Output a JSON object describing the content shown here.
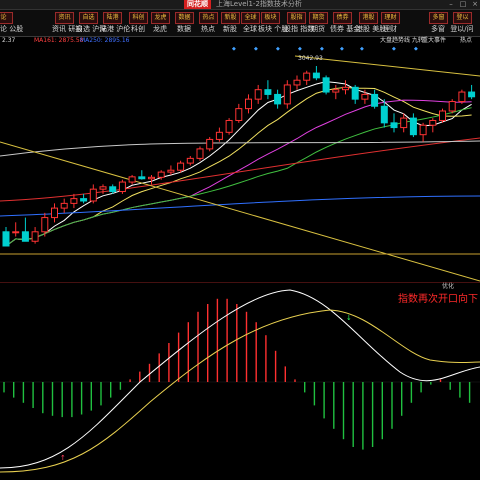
{
  "window": {
    "title": "上海Level1-2指数技术分析",
    "logo": "同花顺"
  },
  "toolbar": {
    "buttons": [
      {
        "label": "论 公股",
        "icon": "论"
      },
      {
        "label": "资讯 研报",
        "icon": "资讯"
      },
      {
        "label": "自选 沪深",
        "icon": "自选"
      },
      {
        "label": "陆港 沪伦",
        "icon": "陆港"
      },
      {
        "label": "科创",
        "icon": "科创"
      },
      {
        "label": "龙虎",
        "icon": "龙虎"
      },
      {
        "label": "数据",
        "icon": "数据"
      },
      {
        "label": "热点",
        "icon": "热点"
      },
      {
        "label": "新股",
        "icon": "新股"
      },
      {
        "label": "全球",
        "icon": "全球"
      },
      {
        "label": "板块 个股",
        "icon": "板块"
      },
      {
        "label": "股指 指数",
        "icon": "股指"
      },
      {
        "label": "期货",
        "icon": "期货"
      },
      {
        "label": "债券 基金",
        "icon": "债券"
      },
      {
        "label": "港股 美股",
        "icon": "港股"
      },
      {
        "label": "理财",
        "icon": "理财"
      },
      {
        "label": "多窗",
        "icon": "多窗"
      },
      {
        "label": "登以/问",
        "icon": "登以"
      }
    ]
  },
  "indicator_bar": {
    "left_value": "2.37",
    "ma60": "MA161: 2875.58",
    "ma250": "MA250: 2895.16",
    "right_items": [
      "大盘趋势线 九转",
      "重大事件",
      "热点"
    ]
  },
  "main_chart": {
    "high_label": "3042.93",
    "colors": {
      "up": "#ff3333",
      "down": "#00d0d0",
      "ma5": "#ffffff",
      "ma10": "#f0e060",
      "ma20": "#e040e0",
      "ma30": "#40c040",
      "ma60": "#e03030",
      "ma250": "#3070ff",
      "trendline": "#d8c040"
    },
    "candles": [
      [
        3,
        4,
        1,
        0
      ],
      [
        3,
        5,
        2,
        3
      ],
      [
        3,
        6,
        2,
        1
      ],
      [
        1,
        4,
        0.5,
        3
      ],
      [
        3,
        7,
        2,
        6
      ],
      [
        6,
        9,
        5,
        8
      ],
      [
        8,
        10,
        7,
        9
      ],
      [
        9,
        11,
        8,
        10
      ],
      [
        10,
        11,
        9,
        9.5
      ],
      [
        9.5,
        13,
        9,
        12
      ],
      [
        12,
        13,
        11,
        12.5
      ],
      [
        12.5,
        13,
        11,
        11.5
      ],
      [
        11.5,
        14,
        11,
        13.5
      ],
      [
        13.5,
        15,
        13,
        14.6
      ],
      [
        14.6,
        16,
        14,
        14.2
      ],
      [
        14.2,
        15,
        13,
        14.5
      ],
      [
        14.5,
        16,
        14,
        15.6
      ],
      [
        15.6,
        17,
        15,
        16
      ],
      [
        16,
        18,
        15.5,
        17.5
      ],
      [
        17.5,
        19,
        17,
        18.5
      ],
      [
        18.5,
        21,
        18,
        20.5
      ],
      [
        20.5,
        23,
        20,
        22.5
      ],
      [
        22.5,
        25,
        22,
        24
      ],
      [
        24,
        27,
        23.5,
        26.5
      ],
      [
        26.5,
        30,
        26,
        29
      ],
      [
        29,
        32,
        28,
        31
      ],
      [
        31,
        34,
        30,
        33
      ],
      [
        33,
        35,
        31,
        32
      ],
      [
        32,
        33,
        29,
        30
      ],
      [
        30,
        35,
        29,
        34
      ],
      [
        34,
        36,
        33,
        35
      ],
      [
        35,
        37,
        34,
        36.5
      ],
      [
        36.5,
        38,
        35,
        35.5
      ],
      [
        35.5,
        36,
        32,
        32.5
      ],
      [
        32.5,
        34,
        31,
        33
      ],
      [
        33,
        35,
        32,
        33.5
      ],
      [
        33.5,
        34,
        30,
        31
      ],
      [
        31,
        33,
        30,
        32
      ],
      [
        32,
        33,
        29,
        29.5
      ],
      [
        29.5,
        31,
        25,
        26
      ],
      [
        26,
        28,
        24,
        25
      ],
      [
        25,
        28,
        24,
        27
      ],
      [
        27,
        28,
        23,
        23.5
      ],
      [
        23.5,
        26,
        22,
        25.5
      ],
      [
        25.5,
        27,
        24,
        26.5
      ],
      [
        26.5,
        29,
        26,
        28.5
      ],
      [
        28.5,
        31,
        28,
        30.5
      ],
      [
        30.5,
        33,
        30,
        32.5
      ],
      [
        32.5,
        34,
        31,
        31.5
      ]
    ]
  },
  "sub_chart": {
    "label": "优化",
    "annotation": "指数再次开口向下",
    "hist": [
      -8,
      -12,
      -16,
      -20,
      -24,
      -26,
      -27,
      -27,
      -25,
      -22,
      -18,
      -12,
      -6,
      2,
      8,
      14,
      22,
      30,
      38,
      46,
      54,
      60,
      64,
      64,
      60,
      54,
      46,
      36,
      24,
      12,
      2,
      -8,
      -18,
      -28,
      -36,
      -44,
      -50,
      -52,
      -50,
      -44,
      -36,
      -26,
      -16,
      -8,
      -2,
      2,
      -6,
      -12,
      -16
    ]
  }
}
